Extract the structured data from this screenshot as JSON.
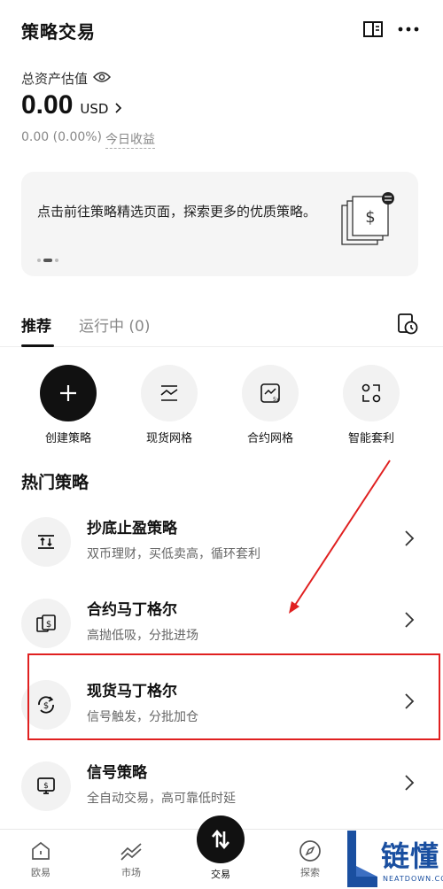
{
  "header": {
    "title": "策略交易"
  },
  "assets": {
    "label": "总资产估值",
    "amount": "0.00",
    "currency": "USD",
    "pnl": "0.00 (0.00%)",
    "pnl_link": "今日收益"
  },
  "promo": {
    "text": "点击前往策略精选页面，探索更多的优质策略。"
  },
  "tabs": [
    {
      "label": "推荐"
    },
    {
      "label": "运行中 (0)"
    }
  ],
  "quick_actions": [
    {
      "label": "创建策略",
      "icon": "plus-icon"
    },
    {
      "label": "现货网格",
      "icon": "grid-chart-icon"
    },
    {
      "label": "合约网格",
      "icon": "futures-grid-icon"
    },
    {
      "label": "智能套利",
      "icon": "arbitrage-icon"
    }
  ],
  "hot": {
    "title": "热门策略",
    "items": [
      {
        "name": "抄底止盈策略",
        "desc": "双币理财，买低卖高，循环套利",
        "icon": "swap-bars-icon"
      },
      {
        "name": "合约马丁格尔",
        "desc": "高抛低吸，分批进场",
        "icon": "dollar-cards-icon"
      },
      {
        "name": "现货马丁格尔",
        "desc": "信号触发，分批加仓",
        "icon": "dollar-cycle-icon"
      },
      {
        "name": "信号策略",
        "desc": "全自动交易，高可靠低时延",
        "icon": "dollar-monitor-icon"
      }
    ]
  },
  "nav": {
    "items": [
      {
        "label": "欧易"
      },
      {
        "label": "市场"
      },
      {
        "label": "交易"
      },
      {
        "label": "探索"
      }
    ]
  },
  "watermark": {
    "brand": "链懂",
    "sub": "NEATDOWN.COM"
  },
  "colors": {
    "accent": "#111111",
    "highlight": "#e02020",
    "watermark": "#1a4fa0"
  }
}
